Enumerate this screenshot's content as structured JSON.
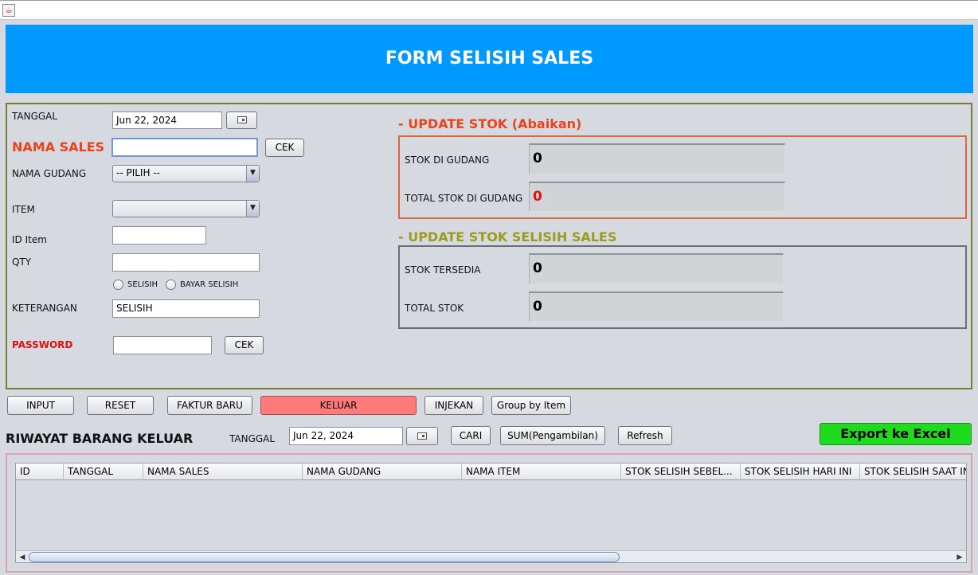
{
  "window": {
    "icon": "java-cup-icon"
  },
  "header": {
    "title": "FORM SELISIH SALES"
  },
  "form": {
    "tanggal_label": "TANGGAL",
    "tanggal_value": "Jun 22, 2024",
    "nama_sales_label": "NAMA SALES",
    "nama_sales_value": "",
    "cek_label": "CEK",
    "nama_gudang_label": "NAMA GUDANG",
    "nama_gudang_value": "-- PILIH --",
    "item_label": "ITEM",
    "item_value": "",
    "id_item_label": "ID Item",
    "id_item_value": "",
    "qty_label": "QTY",
    "qty_value": "",
    "radio_selisih": "SELISIH",
    "radio_bayar_selisih": "BAYAR SELISIH",
    "keterangan_label": "KETERANGAN",
    "keterangan_value": "SELISIH",
    "password_label": "PASSWORD",
    "password_value": "",
    "password_cek_label": "CEK"
  },
  "update_stok": {
    "title": "- UPDATE STOK (Abaikan)",
    "stok_di_gudang_label": "STOK DI GUDANG",
    "stok_di_gudang_value": "0",
    "total_stok_di_gudang_label": "TOTAL STOK DI GUDANG",
    "total_stok_di_gudang_value": "0"
  },
  "update_stok_selisih": {
    "title": "- UPDATE STOK SELISIH SALES",
    "stok_tersedia_label": "STOK TERSEDIA",
    "stok_tersedia_value": "0",
    "total_stok_label": "TOTAL STOK",
    "total_stok_value": "0"
  },
  "actions": {
    "input": "INPUT",
    "reset": "RESET",
    "faktur_baru": "FAKTUR BARU",
    "keluar": "KELUAR",
    "injekan": "INJEKAN",
    "group_by_item": "Group by Item"
  },
  "riwayat": {
    "title": "RIWAYAT BARANG KELUAR",
    "tanggal_label": "TANGGAL",
    "tanggal_value": "Jun 22, 2024",
    "cari": "CARI",
    "sum": "SUM(Pengambilan)",
    "refresh": "Refresh",
    "export": "Export ke Excel"
  },
  "table": {
    "columns": [
      "ID",
      "TANGGAL",
      "NAMA SALES",
      "NAMA GUDANG",
      "NAMA ITEM",
      "STOK SELISIH SEBEL...",
      "STOK SELISIH HARI INI",
      "STOK SELISIH SAAT IN"
    ],
    "rows": []
  },
  "colors": {
    "header_bg": "#0099ff",
    "keluar_btn": "#ff7b7b",
    "export_btn": "#1edb1e",
    "accent_red": "#e8441c",
    "accent_olive": "#9b9b1c"
  }
}
